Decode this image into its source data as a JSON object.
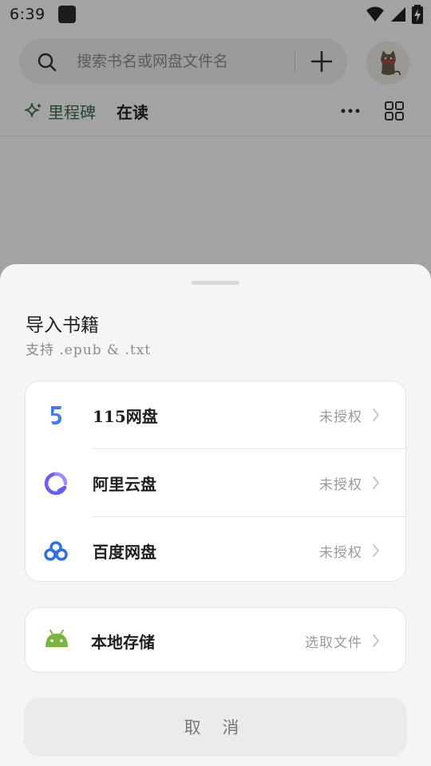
{
  "status_bar": {
    "time": "6:39",
    "icons": [
      "app-notification-icon",
      "wifi-icon",
      "signal-icon",
      "battery-charging-icon"
    ]
  },
  "search": {
    "placeholder": "搜索书名或网盘文件名",
    "value": ""
  },
  "tabs": [
    {
      "label": "里程碑",
      "icon": "sparkle-icon",
      "active": false
    },
    {
      "label": "在读",
      "active": true
    }
  ],
  "toolbar_icons": [
    "add-icon",
    "more-icon",
    "grid-view-icon"
  ],
  "sheet": {
    "title": "导入书籍",
    "subtitle": "支持 .epub & .txt",
    "cloud_items": [
      {
        "label": "115网盘",
        "status": "未授权",
        "icon": "pan-115-icon",
        "color": "#3a7bff"
      },
      {
        "label": "阿里云盘",
        "status": "未授权",
        "icon": "aliyun-drive-icon",
        "color": "#6b5cff"
      },
      {
        "label": "百度网盘",
        "status": "未授权",
        "icon": "baidu-netdisk-icon",
        "color": "#2f6fe8"
      }
    ],
    "local_item": {
      "label": "本地存储",
      "status": "选取文件",
      "icon": "android-icon",
      "color": "#7cb342"
    },
    "cancel_label": "取 消"
  }
}
